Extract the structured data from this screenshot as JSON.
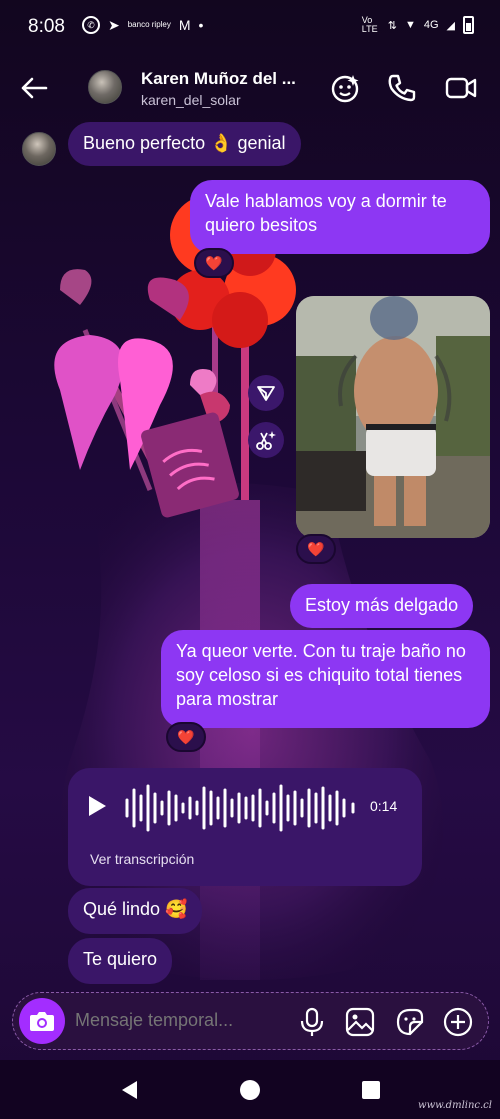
{
  "status_bar": {
    "time": "8:08",
    "network": "4G",
    "volte": "Vo LTE",
    "brand": "banco ripley"
  },
  "header": {
    "name": "Karen Muñoz del ...",
    "username": "karen_del_solar",
    "icons": [
      "back-arrow-icon",
      "effects-icon",
      "phone-icon",
      "video-icon"
    ]
  },
  "messages": [
    {
      "id": "m1",
      "direction": "incoming",
      "text": "Bueno perfecto 👌 genial"
    },
    {
      "id": "m2",
      "direction": "outgoing",
      "text": "Vale hablamos voy a dormir te quiero besitos",
      "reaction": "❤️"
    },
    {
      "id": "m3",
      "direction": "outgoing",
      "type": "photo",
      "reaction": "❤️"
    },
    {
      "id": "m4",
      "direction": "outgoing",
      "text": "Estoy más delgado"
    },
    {
      "id": "m5",
      "direction": "outgoing",
      "text": "Ya queor verte. Con tu traje baño no soy celoso si es chiquito total tienes para mostrar",
      "reaction": "❤️"
    },
    {
      "id": "m6",
      "direction": "incoming",
      "type": "voice",
      "duration": "0:14",
      "transcription_label": "Ver transcripción"
    },
    {
      "id": "m7",
      "direction": "incoming",
      "text": "Qué lindo 🥰"
    },
    {
      "id": "m8",
      "direction": "incoming",
      "text": "Te quiero"
    }
  ],
  "composer": {
    "placeholder": "Mensaje temporal...",
    "icons": [
      "camera-icon",
      "microphone-icon",
      "gallery-icon",
      "sticker-icon",
      "plus-icon"
    ]
  },
  "watermark": "www.dmlinc.cl",
  "colors": {
    "outgoing_bubble": "#8d37f3",
    "incoming_bubble": "#3a1668",
    "background": "#1a0730",
    "camera_button": "#a32dff"
  }
}
